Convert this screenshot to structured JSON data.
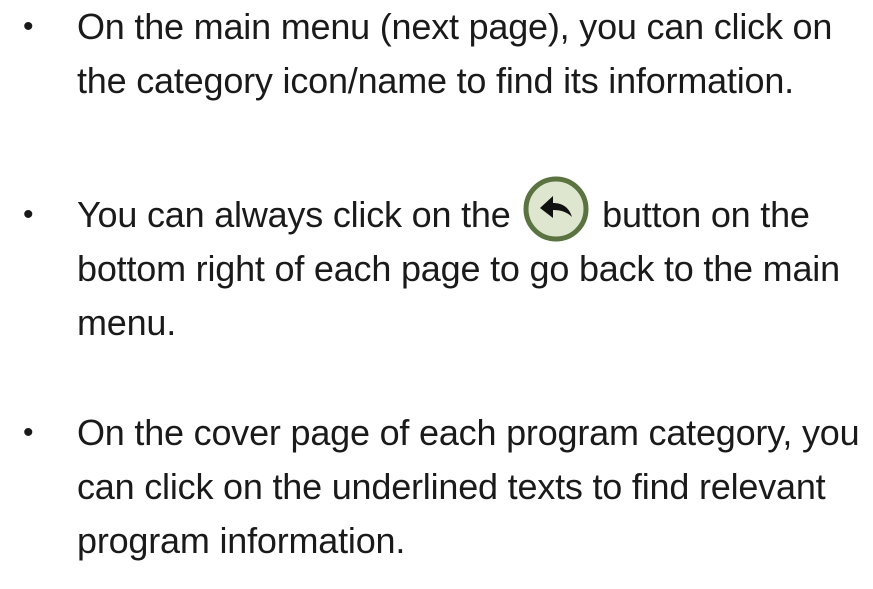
{
  "bullets": [
    {
      "text": "On the main menu (next page), you can click on the category icon/name to find its information."
    },
    {
      "text_before": "You can always click on the ",
      "icon": "back-arrow-icon",
      "text_after": " button on the bottom right of each page to go back to the main menu."
    },
    {
      "text": "On the cover page of each program category, you can click on the underlined texts to find relevant program information."
    }
  ],
  "colors": {
    "icon_fill": "#dfe6cf",
    "icon_border": "#5a7341",
    "icon_arrow": "#111111",
    "text": "#1a1a1a"
  }
}
